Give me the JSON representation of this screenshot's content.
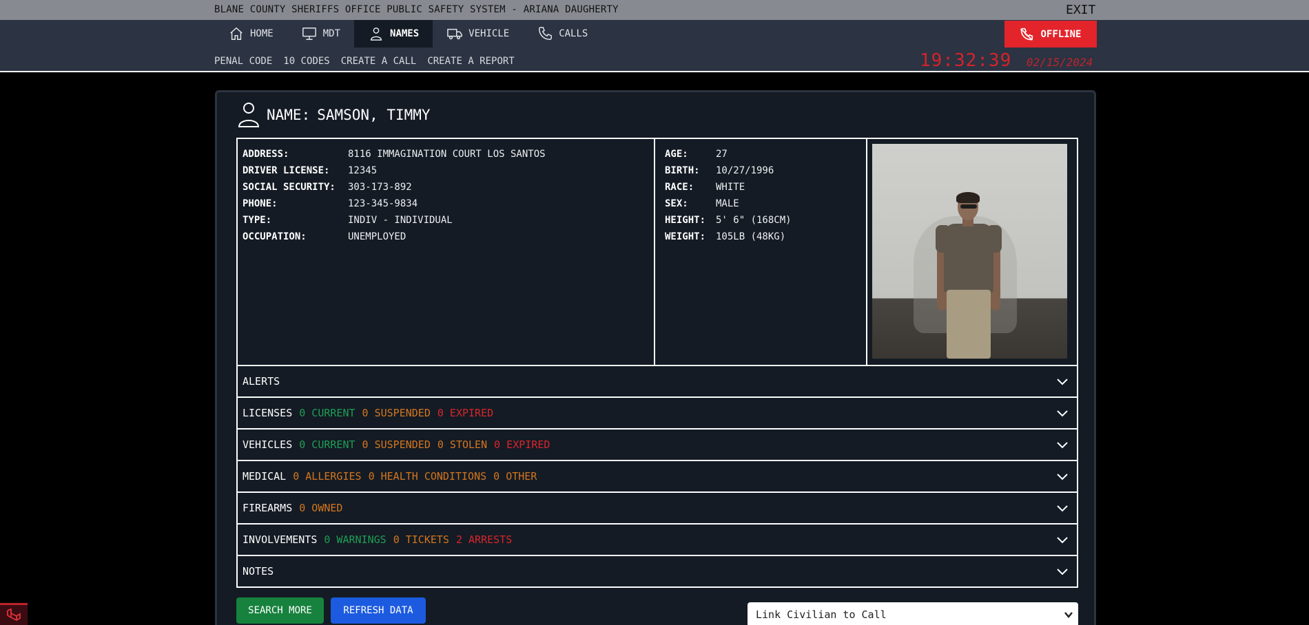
{
  "window": {
    "title": "BLANE COUNTY SHERIFFS OFFICE PUBLIC SAFETY SYSTEM - ARIANA DAUGHERTY",
    "exit": "EXIT"
  },
  "nav": {
    "items": [
      {
        "label": "HOME",
        "icon": "home-icon"
      },
      {
        "label": "MDT",
        "icon": "monitor-icon"
      },
      {
        "label": "NAMES",
        "icon": "user-icon"
      },
      {
        "label": "VEHICLE",
        "icon": "truck-icon"
      },
      {
        "label": "CALLS",
        "icon": "phone-icon"
      }
    ],
    "active": "NAMES",
    "offline": "OFFLINE",
    "sub": [
      "PENAL CODE",
      "10 CODES",
      "CREATE A CALL",
      "CREATE A REPORT"
    ],
    "time": "19:32:39",
    "date": "02/15/2024"
  },
  "person": {
    "name_label": "NAME:",
    "name": "SAMSON, TIMMY",
    "left": [
      {
        "label": "ADDRESS:",
        "value": "8116 IMMAGINATION COURT LOS SANTOS"
      },
      {
        "label": "DRIVER LICENSE:",
        "value": "12345"
      },
      {
        "label": "SOCIAL SECURITY:",
        "value": "303-173-892"
      },
      {
        "label": "PHONE:",
        "value": "123-345-9834"
      },
      {
        "label": "TYPE:",
        "value": "INDIV - INDIVIDUAL"
      },
      {
        "label": "OCCUPATION:",
        "value": "UNEMPLOYED"
      }
    ],
    "right": [
      {
        "label": "AGE:",
        "value": "27"
      },
      {
        "label": "BIRTH:",
        "value": "10/27/1996"
      },
      {
        "label": "RACE:",
        "value": "WHITE"
      },
      {
        "label": "SEX:",
        "value": "MALE"
      },
      {
        "label": "HEIGHT:",
        "value": "5' 6\" (168CM)"
      },
      {
        "label": "WEIGHT:",
        "value": "105LB (48KG)"
      }
    ]
  },
  "sections": {
    "alerts": {
      "title": "ALERTS"
    },
    "licenses": {
      "title": "LICENSES",
      "current": "0 CURRENT",
      "suspended": "0 SUSPENDED",
      "expired": "0 EXPIRED"
    },
    "vehicles": {
      "title": "VEHICLES",
      "current": "0 CURRENT",
      "suspended": "0 SUSPENDED",
      "stolen": "0 STOLEN",
      "expired": "0 EXPIRED"
    },
    "medical": {
      "title": "MEDICAL",
      "allergies": "0 ALLERGIES",
      "health": "0 HEALTH CONDITIONS",
      "other": "0 OTHER"
    },
    "firearms": {
      "title": "FIREARMS",
      "owned": "0 OWNED"
    },
    "involvements": {
      "title": "INVOLVEMENTS",
      "warnings": "0 WARNINGS",
      "tickets": "0 TICKETS",
      "arrests": "2 ARRESTS"
    },
    "notes": {
      "title": "NOTES"
    }
  },
  "actions": {
    "search_more": "SEARCH MORE",
    "refresh": "REFRESH DATA",
    "link_select": "Link Civilian to Call"
  },
  "colors": {
    "accent_red": "#e3242b",
    "green": "#1e9e54",
    "orange": "#d4761f",
    "red": "#d9252c",
    "blue_button": "#1c5be0",
    "green_button": "#17823e"
  }
}
